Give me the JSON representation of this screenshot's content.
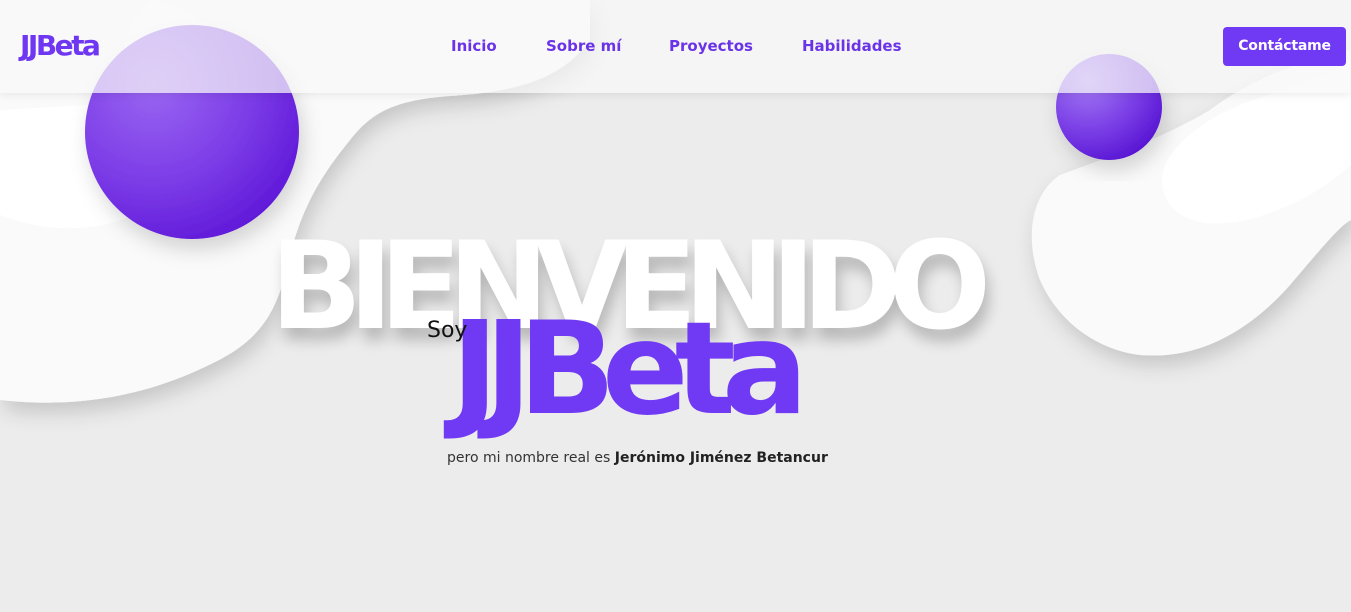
{
  "header": {
    "logo": "JJBeta",
    "nav": [
      {
        "label": "Inicio"
      },
      {
        "label": "Sobre mí"
      },
      {
        "label": "Proyectos"
      },
      {
        "label": "Habilidades"
      }
    ],
    "cta_label": "Contáctame"
  },
  "hero": {
    "welcome": "BIENVENIDO",
    "soy": "Soy",
    "brand": "JJBeta",
    "realname_prefix": "pero mi nombre real es ",
    "realname": "Jerónimo Jiménez Betancur"
  },
  "colors": {
    "accent": "#7039f3",
    "background": "#ececec",
    "blob": "#fafafa"
  }
}
